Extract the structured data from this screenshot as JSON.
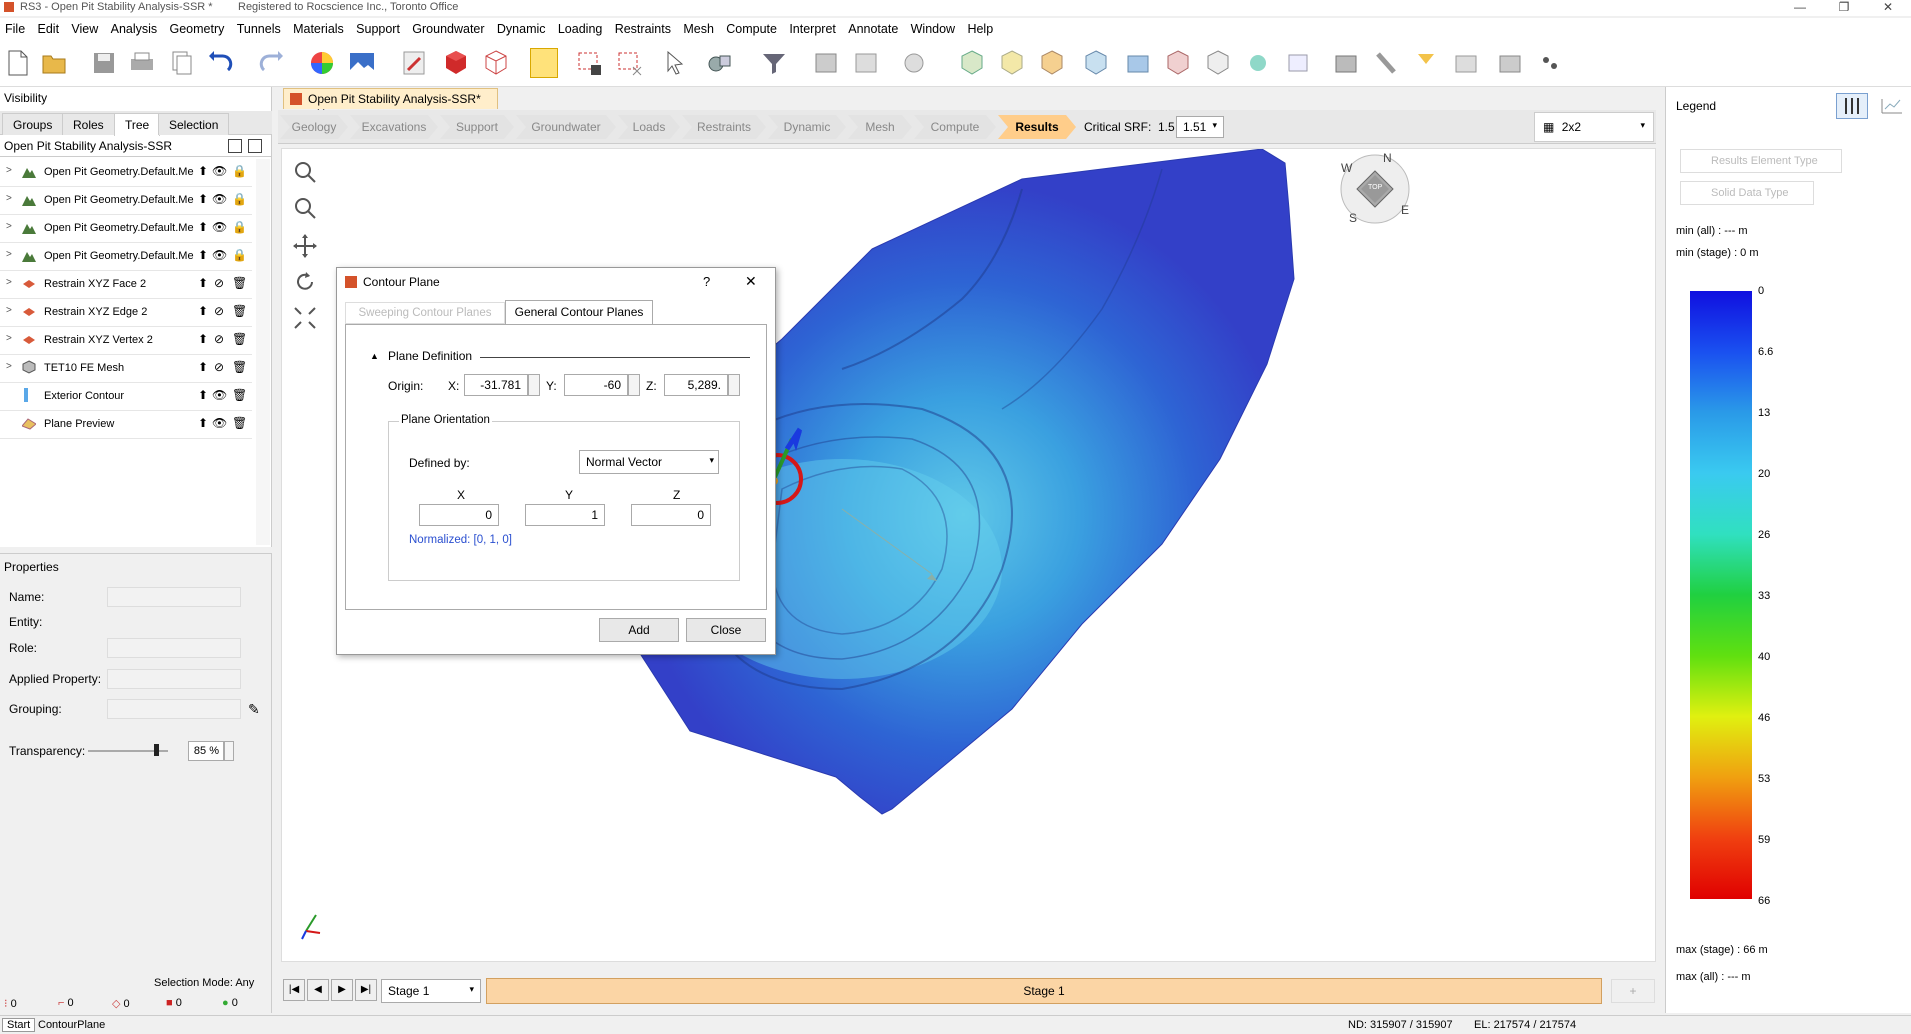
{
  "window": {
    "title": "RS3 - Open Pit Stability Analysis-SSR *",
    "registration": "Registered to Rocscience Inc., Toronto Office",
    "minimize": "—",
    "maximize": "❐",
    "close": "✕"
  },
  "menu": [
    "File",
    "Edit",
    "View",
    "Analysis",
    "Geometry",
    "Tunnels",
    "Materials",
    "Support",
    "Groundwater",
    "Dynamic",
    "Loading",
    "Restraints",
    "Mesh",
    "Compute",
    "Interpret",
    "Annotate",
    "Window",
    "Help"
  ],
  "visibility": {
    "title": "Visibility",
    "tabs": [
      "Groups",
      "Roles",
      "Tree",
      "Selection"
    ],
    "active_tab": "Tree",
    "root": "Open Pit Stability Analysis-SSR",
    "items": [
      {
        "label": "Open Pit Geometry.Default.Mesh",
        "icon": "geometry-icon"
      },
      {
        "label": "Open Pit Geometry.Default.Mesh",
        "icon": "geometry-icon"
      },
      {
        "label": "Open Pit Geometry.Default.Mesh",
        "icon": "geometry-icon"
      },
      {
        "label": "Open Pit Geometry.Default.Mesh",
        "icon": "geometry-icon"
      },
      {
        "label": "Restrain XYZ Face 2",
        "icon": "restraint-icon"
      },
      {
        "label": "Restrain XYZ Edge 2",
        "icon": "restraint-icon"
      },
      {
        "label": "Restrain XYZ Vertex 2",
        "icon": "restraint-icon"
      },
      {
        "label": "TET10 FE Mesh",
        "icon": "mesh-icon"
      },
      {
        "label": "Exterior Contour",
        "icon": "contour-icon"
      },
      {
        "label": "Plane Preview",
        "icon": "plane-icon"
      }
    ]
  },
  "properties": {
    "title": "Properties",
    "name_label": "Name:",
    "entity_label": "Entity:",
    "role_label": "Role:",
    "applied_property_label": "Applied Property:",
    "grouping_label": "Grouping:",
    "transparency_label": "Transparency:",
    "transparency_value": "85 %",
    "transparency_fraction": 0.85,
    "selection_mode": "Selection Mode: Any",
    "counts": [
      "0",
      "0",
      "0",
      "0",
      "0"
    ]
  },
  "view_tab": {
    "label": "Open Pit Stability Analysis-SSR*",
    "close": "✕"
  },
  "workflow": {
    "steps": [
      "Geology",
      "Excavations",
      "Support",
      "Groundwater",
      "Loads",
      "Restraints",
      "Dynamic",
      "Mesh",
      "Compute",
      "Results"
    ],
    "active": "Results",
    "critical_srf_label": "Critical SRF:",
    "critical_srf_value": "1.5",
    "critical_srf_select": "1.51",
    "layout": "2x2"
  },
  "compass": {
    "n": "N",
    "w": "W",
    "s": "S",
    "e": "E",
    "face": "TOP"
  },
  "dialog": {
    "title": "Contour Plane",
    "help": "?",
    "close": "✕",
    "tabs": [
      "Sweeping Contour Planes",
      "General Contour Planes"
    ],
    "section": "Plane Definition",
    "origin_label": "Origin:",
    "x_label": "X:",
    "y_label": "Y:",
    "z_label": "Z:",
    "origin_x": "-31.781",
    "origin_y": "-60",
    "origin_z": "5,289.",
    "orientation_title": "Plane Orientation",
    "defined_by_label": "Defined by:",
    "defined_by_value": "Normal Vector",
    "col_x": "X",
    "col_y": "Y",
    "col_z": "Z",
    "vec_x": "0",
    "vec_y": "1",
    "vec_z": "0",
    "normalized": "Normalized: [0, 1, 0]",
    "add_button": "Add",
    "close_button": "Close"
  },
  "stage": {
    "select": "Stage 1",
    "bar": "Stage 1",
    "plus": "+"
  },
  "legend": {
    "title": "Legend",
    "results_element_type": "Results Element Type",
    "solid_data_type": "Solid Data Type",
    "min_all": "min (all) :     --- m",
    "min_stage": "min (stage) : 0 m",
    "max_stage": "max (stage) : 66 m",
    "max_all": "max (all) :      --- m",
    "ticks": [
      "0",
      "6.6",
      "13",
      "20",
      "26",
      "33",
      "40",
      "46",
      "53",
      "59",
      "66"
    ]
  },
  "status": {
    "start": "Start",
    "mode": "ContourPlane",
    "nd": "ND: 315907 / 315907",
    "el": "EL: 217574 / 217574"
  },
  "colors": {
    "accent": "#ffcd8a",
    "stage_bar": "#fbd5a5",
    "link": "#2a4fd0"
  }
}
